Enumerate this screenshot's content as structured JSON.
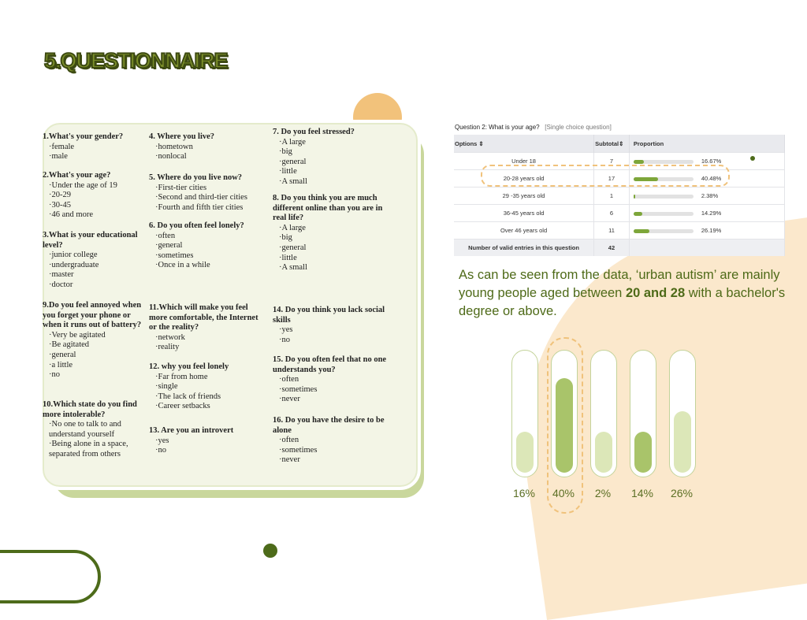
{
  "title": "5.QUESTIONNAIRE",
  "questions_col1": [
    {
      "q": "1.What's your gender?",
      "options": [
        "·female",
        "·male"
      ]
    },
    {
      "q": "2.What's your age?",
      "options": [
        "·Under the age of 19",
        "·20-29",
        "·30-45",
        "·46 and more"
      ]
    },
    {
      "q": "3.What is your educational level?",
      "options": [
        "·junior college",
        "·undergraduate",
        "·master",
        "·doctor"
      ]
    },
    {
      "q": "9.Do you feel annoyed when you forget your phone or when it runs out of battery?",
      "options": [
        "·Very be agitated",
        "·Be agitated",
        "·general",
        "·a little",
        "·no"
      ]
    },
    {
      "q": "10.Which state do you find more intolerable?",
      "options": [
        "·No one to talk to and understand yourself",
        "·Being alone in a space, separated from others"
      ]
    }
  ],
  "questions_col2": [
    {
      "q": "4. Where you live?",
      "options": [
        "·hometown",
        "·nonlocal"
      ]
    },
    {
      "q": "5. Where do you live now?",
      "options": [
        "·First-tier cities",
        "·Second and third-tier cities",
        "·Fourth and fifth tier cities"
      ]
    },
    {
      "q": "6. Do you often feel lonely?",
      "options": [
        "·often",
        "·general",
        "·sometimes",
        "·Once in a while"
      ]
    },
    {
      "q": "11.Which will make you feel more comfortable, the Internet or the reality?",
      "options": [
        "·network",
        "·reality"
      ]
    },
    {
      "q": "12. why you feel lonely",
      "options": [
        "·Far from home",
        "·single",
        "·The lack of friends",
        "·Career setbacks"
      ]
    },
    {
      "q": "13. Are you an introvert",
      "options": [
        "·yes",
        "·no"
      ]
    }
  ],
  "questions_col3": [
    {
      "q": "7. Do you feel stressed?",
      "options": [
        "·A large",
        "·big",
        "·general",
        "·little",
        "·A small"
      ]
    },
    {
      "q": "8. Do you think you are much different online than you are in real life?",
      "options": [
        "·A large",
        "·big",
        "·general",
        "·little",
        "·A small"
      ]
    },
    {
      "q": "14. Do you think you lack social skills",
      "options": [
        "·yes",
        "·no"
      ]
    },
    {
      "q": "15. Do you often feel that no one understands you?",
      "options": [
        "·often",
        "·sometimes",
        "·never"
      ]
    },
    {
      "q": "16. Do you have the desire to be alone",
      "options": [
        "·often",
        "·sometimes",
        "·never"
      ]
    }
  ],
  "survey": {
    "question": "Question 2:  What is your age?",
    "type": "[Single choice question]",
    "headers": [
      "Options ⇕",
      "Subtotal⇕",
      "Proportion"
    ],
    "rows": [
      {
        "option": "Under 18",
        "subtotal": "7",
        "proportion": "16.67%",
        "value": 16.67
      },
      {
        "option": "20-28  years old",
        "subtotal": "17",
        "proportion": "40.48%",
        "value": 40.48
      },
      {
        "option": "29 -35 years old",
        "subtotal": "1",
        "proportion": "2.38%",
        "value": 2.38
      },
      {
        "option": "36-45 years old",
        "subtotal": "6",
        "proportion": "14.29%",
        "value": 14.29
      },
      {
        "option": "Over 46 years old",
        "subtotal": "11",
        "proportion": "26.19%",
        "value": 26.19
      }
    ],
    "footer_label": "Number of valid entries in this question",
    "footer_value": "42"
  },
  "note": {
    "part1": " As can be seen from the data, ‘urban autism’ are mainly young people aged between ",
    "bold": "20 and 28",
    "part2": " with a bachelor's degree or above."
  },
  "chart_data": {
    "type": "bar",
    "categories": [
      "16%",
      "40%",
      "2%",
      "14%",
      "26%"
    ],
    "values": [
      16,
      40,
      2,
      14,
      26
    ],
    "ylim": [
      0,
      50
    ],
    "colors": [
      "#dce7b8",
      "#a9c46a",
      "#dce7b8",
      "#a9c46a",
      "#dce7b8"
    ]
  }
}
